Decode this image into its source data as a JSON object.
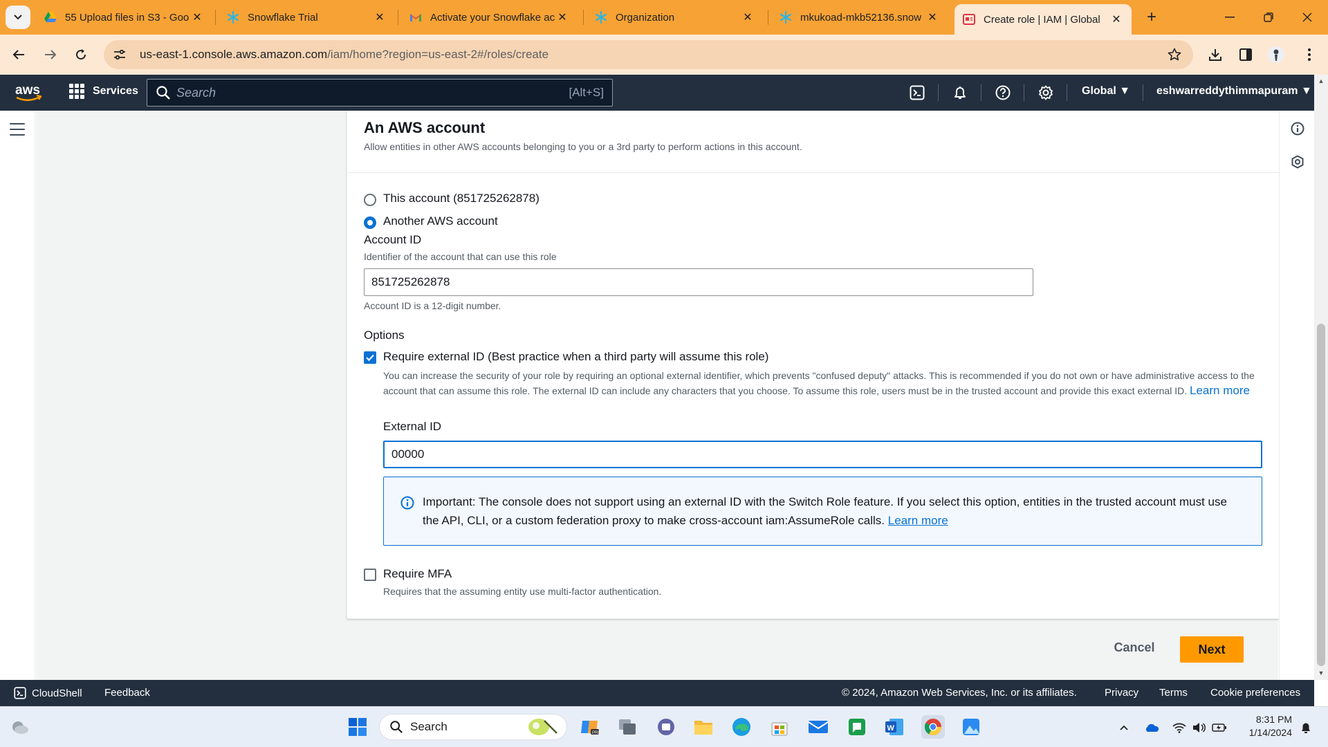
{
  "browser": {
    "tabs": [
      {
        "title": "55 Upload files in S3 - Goo",
        "icon": "google-drive-icon",
        "active": false
      },
      {
        "title": "Snowflake Trial",
        "icon": "snowflake-icon",
        "active": false
      },
      {
        "title": "Activate your Snowflake ac",
        "icon": "gmail-icon",
        "active": false
      },
      {
        "title": "Organization",
        "icon": "snowflake-icon",
        "active": false
      },
      {
        "title": "mkukoad-mkb52136.snow",
        "icon": "snowflake-icon",
        "active": false
      },
      {
        "title": "Create role | IAM | Global",
        "icon": "aws-iam-icon",
        "active": true
      }
    ],
    "url_host": "us-east-1.console.aws.amazon.com",
    "url_path": "/iam/home?region=us-east-2#/roles/create"
  },
  "aws_header": {
    "logo": "aws",
    "services_label": "Services",
    "search_placeholder": "Search",
    "search_shortcut": "[Alt+S]",
    "region": "Global",
    "user": "eshwarreddythimmapuram"
  },
  "section": {
    "title": "An AWS account",
    "description": "Allow entities in other AWS accounts belonging to you or a 3rd party to perform actions in this account."
  },
  "account_choice": {
    "this_account": "This account (851725262878)",
    "another_account": "Another AWS account",
    "selected": "another_account"
  },
  "account_id": {
    "label": "Account ID",
    "description": "Identifier of the account that can use this role",
    "value": "851725262878",
    "hint": "Account ID is a 12-digit number."
  },
  "options": {
    "heading": "Options",
    "external_id_checkbox": {
      "label": "Require external ID (Best practice when a third party will assume this role)",
      "checked": true,
      "description": "You can increase the security of your role by requiring an optional external identifier, which prevents \"confused deputy\" attacks. This is recommended if you do not own or have administrative access to the account that can assume this role. The external ID can include any characters that you choose. To assume this role, users must be in the trusted account and provide this exact external ID.",
      "learn_more": "Learn more"
    },
    "external_id": {
      "label": "External ID",
      "value": "00000"
    },
    "alert": {
      "text": "Important: The console does not support using an external ID with the Switch Role feature. If you select this option, entities in the trusted account must use the API, CLI, or a custom federation proxy to make cross-account iam:AssumeRole calls.",
      "learn_more": "Learn more"
    },
    "mfa_checkbox": {
      "label": "Require MFA",
      "checked": false,
      "description": "Requires that the assuming entity use multi-factor authentication."
    }
  },
  "actions": {
    "cancel": "Cancel",
    "next": "Next"
  },
  "aws_footer": {
    "cloudshell": "CloudShell",
    "feedback": "Feedback",
    "copyright": "© 2024, Amazon Web Services, Inc. or its affiliates.",
    "privacy": "Privacy",
    "terms": "Terms",
    "cookies": "Cookie preferences"
  },
  "taskbar": {
    "search_label": "Search",
    "time": "8:31 PM",
    "date": "1/14/2024"
  },
  "colors": {
    "chrome_tabstrip": "#f7a235",
    "chrome_toolbar": "#fde8d3",
    "aws_navy": "#232f3e",
    "aws_link": "#0972d3",
    "aws_orange": "#ff9900"
  }
}
